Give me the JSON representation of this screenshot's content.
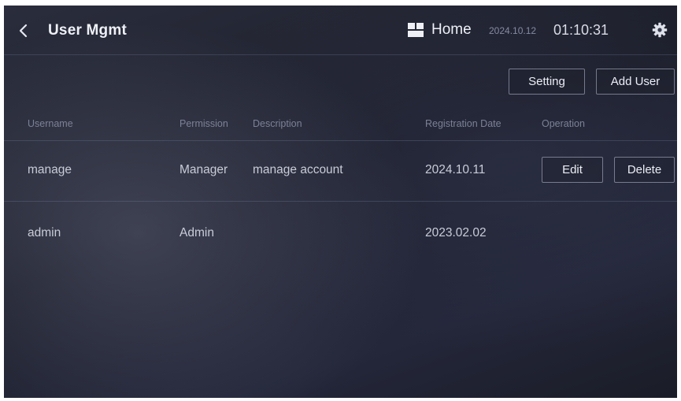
{
  "header": {
    "title": "User Mgmt",
    "home_label": "Home",
    "date": "2024.10.12",
    "time": "01:10:31"
  },
  "toolbar": {
    "setting_label": "Setting",
    "add_user_label": "Add User"
  },
  "table": {
    "columns": [
      "Username",
      "Permission",
      "Description",
      "Registration Date",
      "Operation"
    ],
    "rows": [
      {
        "username": "manage",
        "permission": "Manager",
        "description": "manage account",
        "registration_date": "2024.10.11",
        "edit_label": "Edit",
        "delete_label": "Delete"
      },
      {
        "username": "admin",
        "permission": "Admin",
        "description": "",
        "registration_date": "2023.02.02"
      }
    ]
  },
  "icons": {
    "back": "chevron-left-icon",
    "home": "home-grid-icon",
    "settings": "gear-icon"
  },
  "colors": {
    "background": "#1f2130",
    "text": "#d8dbe6",
    "muted_text": "#7c8196"
  }
}
